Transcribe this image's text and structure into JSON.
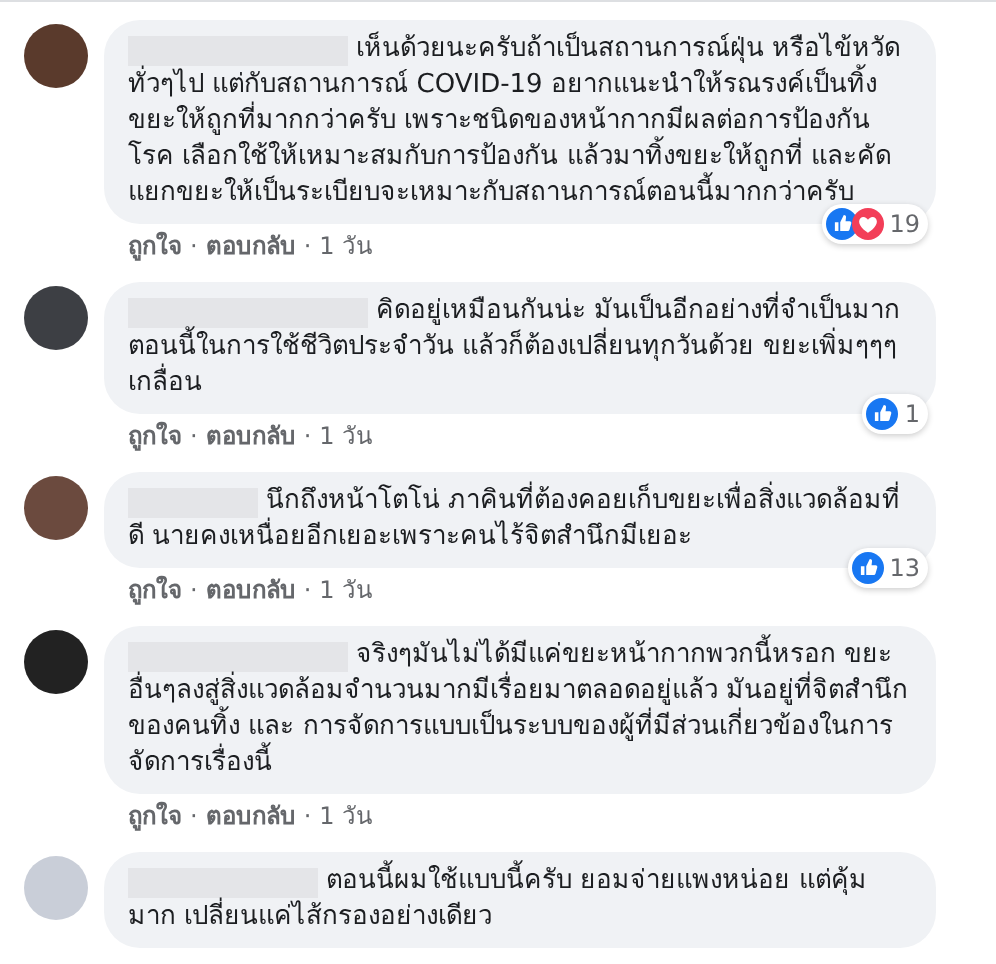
{
  "comments": [
    {
      "text": "เห็นด้วยนะครับถ้าเป็นสถานการณ์ฝุ่น หรือไข้หวัดทั่วๆไป แต่กับสถานการณ์ COVID-19 อยากแนะนำให้รณรงค์เป็นทิ้งขยะให้ถูกที่มากกว่าครับ เพราะชนิดของหน้ากากมีผลต่อการป้องกันโรค เลือกใช้ให้เหมาะสมกับการป้องกัน แล้วมาทิ้งขยะให้ถูกที่ และคัดแยกขยะให้เป็นระเบียบจะเหมาะกับสถานการณ์ตอนนี้มากกว่าครับ",
      "love": true,
      "reaction_count": "19",
      "actions": [
        {
          "kind": "link",
          "text": "ถูกใจ"
        },
        {
          "kind": "separator",
          "text": "·"
        },
        {
          "kind": "link",
          "text": "ตอบกลับ"
        },
        {
          "kind": "separator",
          "text": "·"
        },
        {
          "kind": "time",
          "text": "1 วัน"
        }
      ]
    },
    {
      "text": "คิดอยู่เหมือนกันน่ะ มันเป็นอีกอย่างที่จำเป็นมากตอนนี้ในการใช้ชีวิตประจำวัน แล้วก็ต้องเปลี่ยนทุกวันด้วย ขยะเพิ่มๆๆๆ เกลื่อน",
      "love": false,
      "reaction_count": "1",
      "actions": [
        {
          "kind": "link",
          "text": "ถูกใจ"
        },
        {
          "kind": "separator",
          "text": "·"
        },
        {
          "kind": "link",
          "text": "ตอบกลับ"
        },
        {
          "kind": "separator",
          "text": "·"
        },
        {
          "kind": "time",
          "text": "1 วัน"
        }
      ]
    },
    {
      "text": "นึกถึงหน้าโตโน่ ภาคินที่ต้องคอยเก็บขยะเพื่อสิ่งแวดล้อมที่ดี นายคงเหนื่อยอีกเยอะเพราะคนไร้จิตสำนึกมีเยอะ",
      "love": false,
      "reaction_count": "13",
      "actions": [
        {
          "kind": "link",
          "text": "ถูกใจ"
        },
        {
          "kind": "separator",
          "text": "·"
        },
        {
          "kind": "link",
          "text": "ตอบกลับ"
        },
        {
          "kind": "separator",
          "text": "·"
        },
        {
          "kind": "time",
          "text": "1 วัน"
        }
      ]
    },
    {
      "text": "จริงๆมันไม่ได้มีแค่ขยะหน้ากากพวกนี้หรอก ขยะอื่นๆลงสู่สิ่งแวดล้อมจำนวนมากมีเรื่อยมาตลอดอยู่แล้ว มันอยู่ที่จิตสำนึกของคนทิ้ง และ การจัดการแบบเป็นระบบของผู้ที่มีส่วนเกี่ยวข้องในการจัดการเรื่องนี้",
      "actions": [
        {
          "kind": "link",
          "text": "ถูกใจ"
        },
        {
          "kind": "separator",
          "text": "·"
        },
        {
          "kind": "link",
          "text": "ตอบกลับ"
        },
        {
          "kind": "separator",
          "text": "·"
        },
        {
          "kind": "time",
          "text": "1 วัน"
        }
      ]
    },
    {
      "text": "ตอนนี้ผมใช้แบบนี้ครับ ยอมจ่ายแพงหน่อย แต่คุ้มมาก เปลี่ยนแค่ไส้กรองอย่างเดียว"
    }
  ]
}
